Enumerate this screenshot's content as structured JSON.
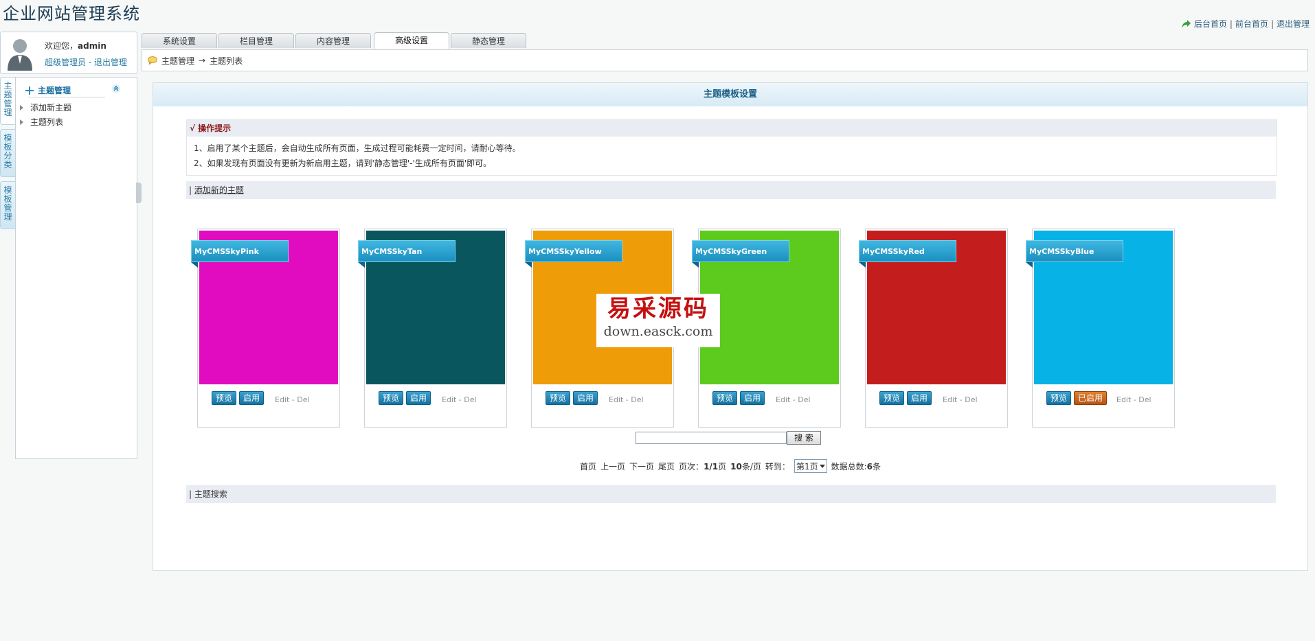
{
  "header": {
    "site_title": "企业网站管理系统",
    "links": [
      "后台首页",
      "前台首页",
      "退出管理"
    ],
    "separator": "|"
  },
  "user": {
    "welcome": "欢迎您，",
    "name": "admin",
    "role": "超级管理员",
    "dash": "-",
    "logout": "退出管理"
  },
  "vtabs": [
    "主题管理",
    "模板分类",
    "模板管理"
  ],
  "sidebar": {
    "heading": "主题管理",
    "items": [
      "添加新主题",
      "主题列表"
    ]
  },
  "tabs": [
    "系统设置",
    "栏目管理",
    "内容管理",
    "高级设置",
    "静态管理"
  ],
  "active_tab": "高级设置",
  "breadcrumb": {
    "first": "主题管理",
    "arrow": "→",
    "second": "主题列表"
  },
  "main": {
    "title": "主题模板设置",
    "tip_heading": "√ 操作提示",
    "tips": [
      "1、启用了某个主题后，会自动生成所有页面，生成过程可能耗费一定时间，请耐心等待。",
      "2、如果发现有页面没有更新为新启用主题，请到'静态管理'-'生成所有页面'即可。"
    ],
    "add_bar_prefix": "| ",
    "add_link": "添加新的主题",
    "search_bar": "| 主题搜索",
    "search_button": "搜 索"
  },
  "themes": [
    {
      "name": "MyCMSSkyPink",
      "color": "#e10cbf",
      "preview": "预览",
      "action": "启用",
      "active": false
    },
    {
      "name": "MyCMSSkyTan",
      "color": "#0a565e",
      "preview": "预览",
      "action": "启用",
      "active": false
    },
    {
      "name": "MyCMSSkyYellow",
      "color": "#ee9c08",
      "preview": "预览",
      "action": "启用",
      "active": false
    },
    {
      "name": "MyCMSSkyGreen",
      "color": "#5dcb1e",
      "preview": "预览",
      "action": "启用",
      "active": false
    },
    {
      "name": "MyCMSSkyRed",
      "color": "#c41d1d",
      "preview": "预览",
      "action": "启用",
      "active": false
    },
    {
      "name": "MyCMSSkyBlue",
      "color": "#07b2e6",
      "preview": "预览",
      "action": "已启用",
      "active": true
    }
  ],
  "edit_del": "Edit - Del",
  "pager": {
    "first": "首页",
    "prev": "上一页",
    "next": "下一页",
    "last": "尾页",
    "page_label": "页次：",
    "page_value": "1/1",
    "page_unit": "页",
    "per_page": "10",
    "per_page_unit": "条/页",
    "goto_label": "转到：",
    "goto_value": "第1页",
    "total_label": "数据总数:",
    "total_value": "6",
    "total_unit": "条"
  },
  "watermark": {
    "cn": "易采源码",
    "en": "down.easck.com"
  },
  "colors": {
    "accent": "#1a6fa0",
    "tip_heading": "#8b1a1a"
  }
}
